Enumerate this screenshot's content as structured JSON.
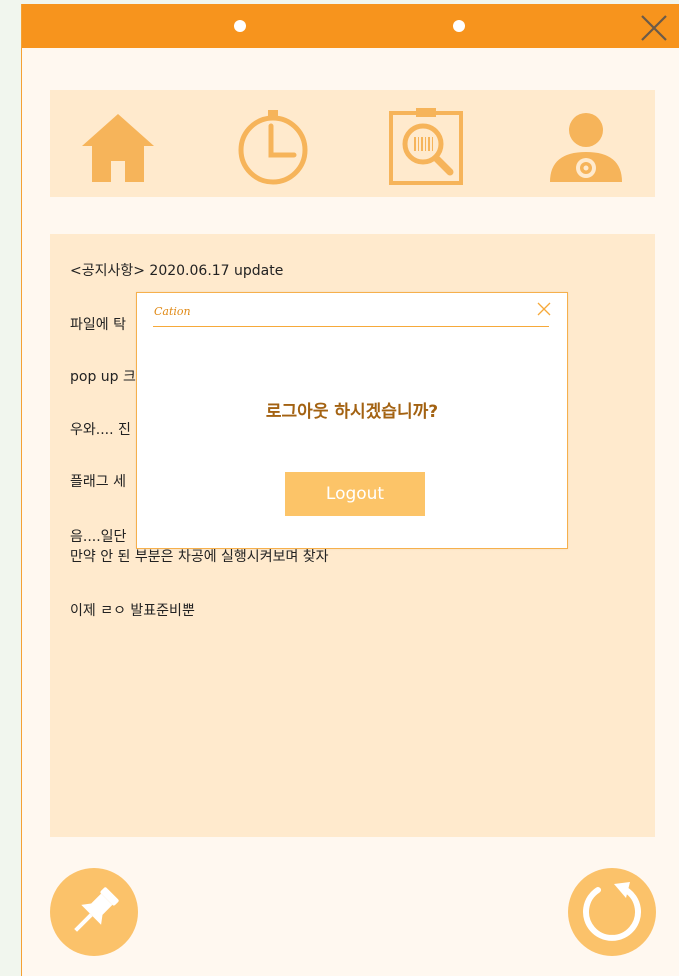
{
  "colors": {
    "accent": "#f7941d",
    "icon": "#f6b45a",
    "panel": "#ffeacd",
    "background": "#fff8f0",
    "button": "#fcc468",
    "message": "#a36212"
  },
  "titlebar": {
    "icons": [
      "dot-indicator",
      "dot-indicator",
      "close-icon"
    ]
  },
  "nav": {
    "items": [
      {
        "icon": "home-icon"
      },
      {
        "icon": "timer-icon"
      },
      {
        "icon": "barcode-scan-icon"
      },
      {
        "icon": "user-settings-icon"
      }
    ]
  },
  "notice": {
    "lines": [
      "<공지사항> 2020.06.17 update",
      "파일에 탁",
      "pop up 크",
      "우와.... 진",
      "플래그 세",
      "음....일단",
      "만약 안 된 부분은 차공에 실행시켜보며 찾자",
      "이제 ㄹㅇ 발표준비뿐"
    ]
  },
  "footer": {
    "left_icon": "pin-icon",
    "right_icon": "refresh-icon"
  },
  "dialog": {
    "title": "Cation",
    "message": "로그아웃 하시겠습니까?",
    "button_label": "Logout"
  }
}
